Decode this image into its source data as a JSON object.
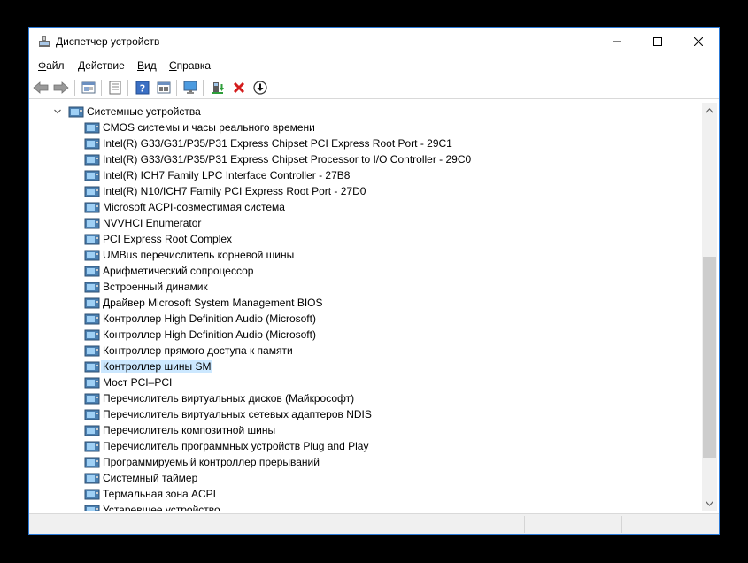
{
  "window": {
    "title": "Диспетчер устройств"
  },
  "menu": [
    {
      "label": "Файл",
      "accel": "Ф",
      "rest": "айл"
    },
    {
      "label": "Действие",
      "accel": "Д",
      "rest": "ействие"
    },
    {
      "label": "Вид",
      "accel": "В",
      "rest": "ид"
    },
    {
      "label": "Справка",
      "accel": "С",
      "rest": "правка"
    }
  ],
  "toolbar": {
    "icons": [
      "back-arrow-icon",
      "forward-arrow-icon",
      "properties-icon",
      "details-icon",
      "help-icon",
      "view-icon",
      "monitor-icon",
      "update-driver-icon",
      "uninstall-icon",
      "download-icon"
    ]
  },
  "tree": {
    "root": "Системные устройства",
    "items": [
      "CMOS системы и часы реального времени",
      "Intel(R) G33/G31/P35/P31 Express Chipset PCI Express Root Port - 29C1",
      "Intel(R) G33/G31/P35/P31 Express Chipset Processor to I/O Controller - 29C0",
      "Intel(R) ICH7 Family LPC Interface Controller - 27B8",
      "Intel(R) N10/ICH7 Family PCI Express Root Port - 27D0",
      "Microsoft ACPI-совместимая система",
      "NVVHCI Enumerator",
      "PCI Express Root Complex",
      "UMBus перечислитель корневой шины",
      "Арифметический сопроцессор",
      "Встроенный динамик",
      "Драйвер Microsoft System Management BIOS",
      "Контроллер High Definition Audio (Microsoft)",
      "Контроллер High Definition Audio (Microsoft)",
      "Контроллер прямого доступа к памяти",
      "Контроллер шины SM",
      "Мост PCI–PCI",
      "Перечислитель виртуальных дисков (Майкрософт)",
      "Перечислитель виртуальных сетевых адаптеров NDIS",
      "Перечислитель композитной шины",
      "Перечислитель программных устройств Plug and Play",
      "Программируемый контроллер прерываний",
      "Системный таймер",
      "Термальная зона ACPI",
      "Устаревшее устройство"
    ],
    "selected_index": 15
  },
  "colors": {
    "window_border": "#2b79d6",
    "selection": "#cce8ff",
    "scroll_thumb": "#cdcdcd"
  }
}
